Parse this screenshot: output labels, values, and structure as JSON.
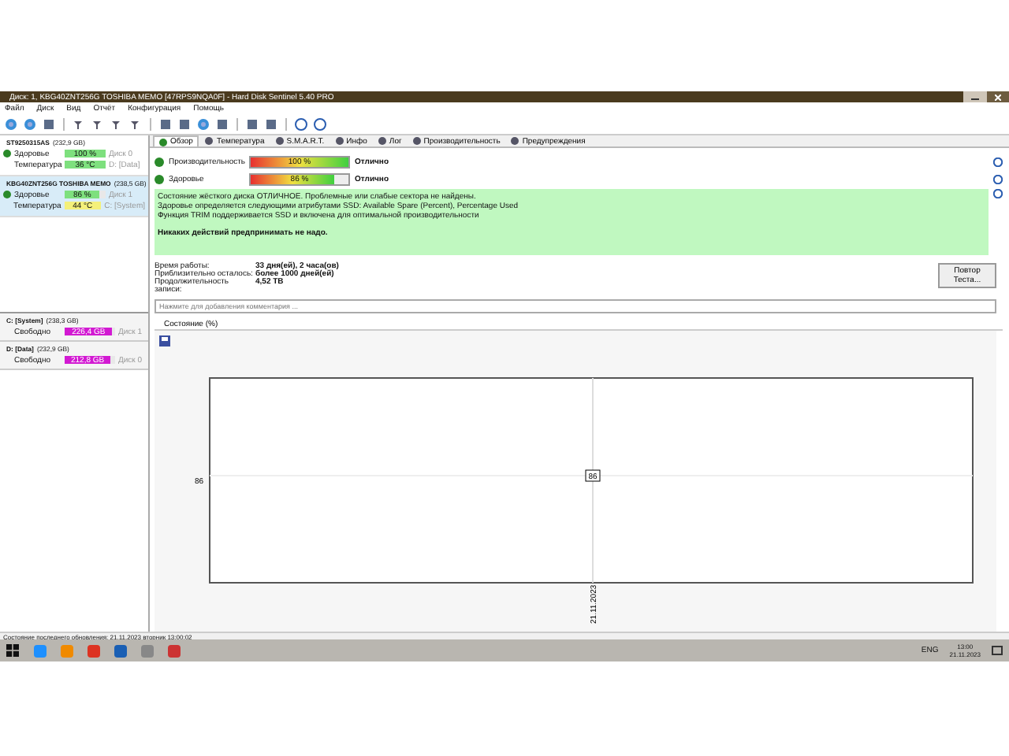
{
  "window": {
    "title": "Диск: 1, KBG40ZNT256G TOSHIBA MEMO [47RPS9NQA0F] - Hard Disk Sentinel 5.40 PRO"
  },
  "menu": [
    "Файл",
    "Диск",
    "Вид",
    "Отчёт",
    "Конфигурация",
    "Помощь"
  ],
  "disks": [
    {
      "name": "ST9250315AS",
      "size": "(232,9 GB)",
      "selected": false,
      "health_label": "Здоровье",
      "health": "100 %",
      "level": 1,
      "disk": "Диск 0",
      "temp_label": "Температура",
      "temp": "36 °C",
      "color": "#7ee07e",
      "volume": "D: [Data]"
    },
    {
      "name": "KBG40ZNT256G TOSHIBA MEMO",
      "size": "(238,5 GB)",
      "selected": true,
      "health_label": "Здоровье",
      "health": "86 %",
      "level": 0.86,
      "disk": "Диск 1",
      "temp_label": "Температура",
      "temp": "44 °C",
      "color": "#f4f07a",
      "volume": "C: [System]"
    }
  ],
  "volumes": [
    {
      "name": "C: [System]",
      "size": "(238,3 GB)",
      "free_label": "Свободно",
      "free": "226,4 GB",
      "level": 0.95,
      "disk": "Диск 1"
    },
    {
      "name": "D: [Data]",
      "size": "(232,9 GB)",
      "free_label": "Свободно",
      "free": "212,8 GB",
      "level": 0.91,
      "disk": "Диск 0"
    }
  ],
  "tabs": [
    {
      "label": "Обзор",
      "selected": true
    },
    {
      "label": "Температура",
      "selected": false
    },
    {
      "label": "S.M.A.R.T.",
      "selected": false
    },
    {
      "label": "Инфо",
      "selected": false
    },
    {
      "label": "Лог",
      "selected": false
    },
    {
      "label": "Производительность",
      "selected": false
    },
    {
      "label": "Предупреждения",
      "selected": false
    }
  ],
  "meters": [
    {
      "label": "Производительность",
      "reading": "100 %",
      "level": 1,
      "rating": "Отлично"
    },
    {
      "label": "Здоровье",
      "reading": "86 %",
      "level": 0.86,
      "rating": "Отлично"
    }
  ],
  "message": [
    "Состояние жёсткого диска ОТЛИЧНОЕ. Проблемные или слабые сектора не найдены.",
    "Здоровье определяется следующими атрибутами SSD: Available Spare (Percent), Percentage Used",
    "Функция TRIM поддерживается SSD и включена для оптимальной производительности"
  ],
  "action": "Никаких действий предпринимать не надо.",
  "stats": [
    {
      "label": "Время работы:",
      "value": "33 дня(ей), 2 часа(ов)"
    },
    {
      "label": "Приблизительно осталось:",
      "value": "более 1000 дней(ей)"
    },
    {
      "label": "Продолжительность записи:",
      "value": "4,52 TB"
    }
  ],
  "retest_button": "Повтор Теста...",
  "comment": {
    "placeholder": "Нажмите для добавления комментария ..."
  },
  "chart_tab": "Состояние (%)",
  "chart": {
    "y_label": "86",
    "x_label": "21.11.2023",
    "point_label": "86"
  },
  "status_bar": "Состояние последнего обновления: 21.11.2023 вторник 13:00:02",
  "tray": {
    "language": "ENG",
    "time": "13:00",
    "date": "21.11.2023"
  }
}
